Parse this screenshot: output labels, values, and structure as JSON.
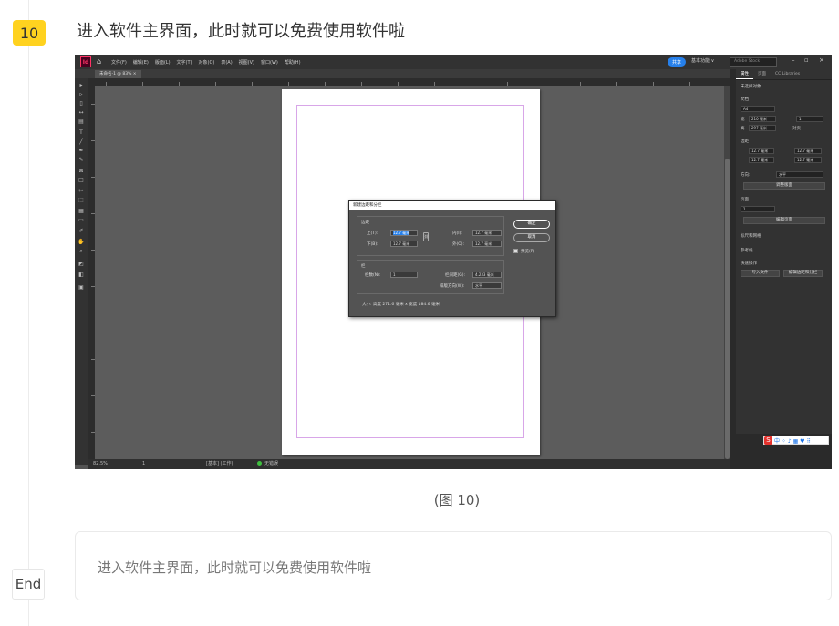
{
  "step": {
    "number": "10",
    "title": "进入软件主界面，此时就可以免费使用软件啦"
  },
  "screenshot": {
    "app_logo": "Id",
    "menu": [
      "文件(F)",
      "编辑(E)",
      "版面(L)",
      "文字(T)",
      "对象(O)",
      "表(A)",
      "视图(V)",
      "窗口(W)",
      "帮助(H)"
    ],
    "share_label": "共享",
    "workspace_label": "基本功能 ∨",
    "stock_search_placeholder": "Adobe Stock",
    "doc_tab": "未命名-1 @ 83% ×",
    "status": {
      "zoom": "82.5%",
      "page": "1",
      "mode": "[基本] (工作)",
      "errors": "无错误"
    },
    "panel": {
      "tabs": [
        "属性",
        "页面",
        "CC Libraries"
      ],
      "no_selection": "未选择对象",
      "document_heading": "文档",
      "preset": "A4",
      "width_label": "宽",
      "width_value": "210 毫米",
      "height_label": "高",
      "height_value": "297 毫米",
      "pages_value": "1",
      "facing_pages": "对页",
      "margins_heading": "边距",
      "margin_value": "12.7 毫米",
      "direction_label": "方向:",
      "direction_value": "水平",
      "adjust_layout_button": "调整版面",
      "pages_heading": "页面",
      "page_select": "1",
      "edit_page_button": "编辑页面",
      "ruler_grid": "标尺和网格",
      "guides": "参考线",
      "quick_actions": "快速操作",
      "import_file_button": "导入文件",
      "edit_margins_button": "编辑边距和分栏"
    },
    "dialog": {
      "title": "新建边距和分栏",
      "margins_heading": "边距",
      "top_label": "上(T):",
      "top_value": "12.7 毫米",
      "bottom_label": "下(B):",
      "bottom_value": "12.7 毫米",
      "inside_label": "内(I):",
      "inside_value": "12.7 毫米",
      "outside_label": "外(O):",
      "outside_value": "12.7 毫米",
      "columns_heading": "栏",
      "columns_label": "栏数(N):",
      "columns_value": "1",
      "gutter_label": "栏间距(G):",
      "gutter_value": "4.233 毫米",
      "direction_label": "排版方向(W):",
      "direction_value": "水平",
      "size_text": "大小: 高度 271.6 毫米 x 宽度 184.6 毫米",
      "ok_button": "确定",
      "cancel_button": "取消",
      "preview_label": "预览(P)"
    },
    "ime": "中 ⁘ ♪ ▦ ♥ ⠿"
  },
  "caption": "(图 10)",
  "end_label": "End",
  "summary_text": "进入软件主界面，此时就可以免费使用软件啦"
}
